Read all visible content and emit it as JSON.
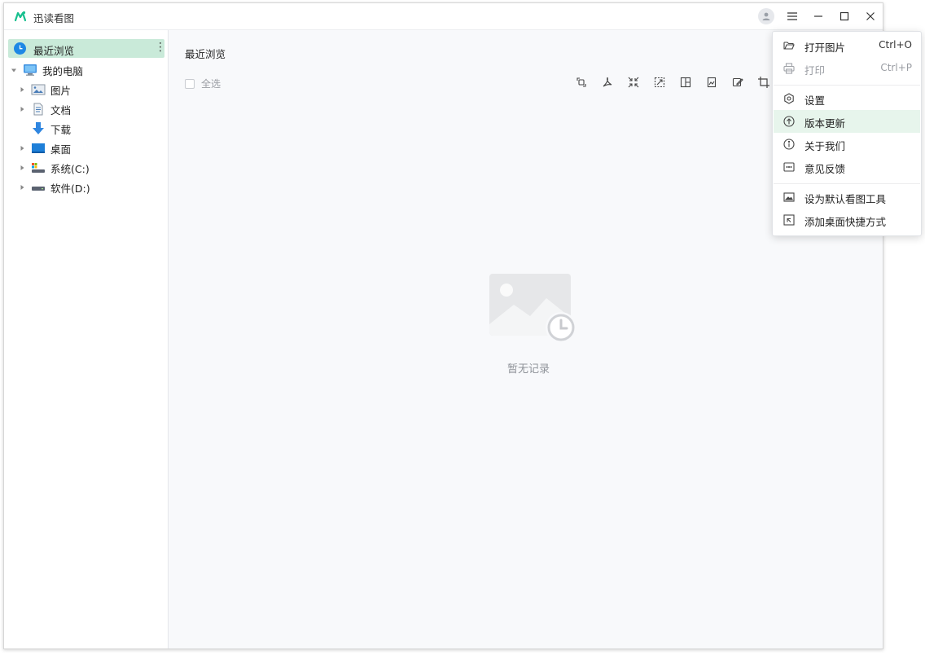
{
  "app": {
    "title": "迅读看图",
    "brand_color": "#18c08f",
    "icon": "app-logo-icon"
  },
  "titlebar": {
    "buttons": [
      "user-avatar-icon",
      "hamburger-menu-icon",
      "minimize-icon",
      "maximize-icon",
      "close-icon"
    ]
  },
  "sidebar": {
    "recent": {
      "label": "最近浏览",
      "icon": "clock-icon",
      "highlight_color": "#c9ead9"
    },
    "tree": [
      {
        "label": "我的电脑",
        "icon": "computer-icon",
        "expanded": true
      },
      {
        "label": "图片",
        "icon": "pictures-folder-icon"
      },
      {
        "label": "文档",
        "icon": "documents-folder-icon"
      },
      {
        "label": "下载",
        "icon": "download-arrow-icon"
      },
      {
        "label": "桌面",
        "icon": "desktop-icon"
      },
      {
        "label": "系统(C:)",
        "icon": "system-drive-icon"
      },
      {
        "label": "软件(D:)",
        "icon": "drive-icon"
      }
    ]
  },
  "main": {
    "breadcrumb": "最近浏览",
    "select_all_label": "全选",
    "toolbar": [
      "convert-icon",
      "pdf-icon",
      "compress-icon",
      "resize-icon",
      "layout-icon",
      "print-image-icon",
      "edit-icon",
      "crop-icon"
    ],
    "empty_text": "暂无记录"
  },
  "menu": {
    "items": [
      {
        "label": "打开图片",
        "shortcut": "Ctrl+O",
        "icon": "folder-open-icon"
      },
      {
        "label": "打印",
        "shortcut": "Ctrl+P",
        "icon": "printer-icon",
        "disabled": true
      },
      {
        "label": "设置",
        "icon": "settings-hex-icon"
      },
      {
        "label": "版本更新",
        "icon": "update-arrow-icon",
        "highlighted": true
      },
      {
        "label": "关于我们",
        "icon": "info-icon"
      },
      {
        "label": "意见反馈",
        "icon": "feedback-icon"
      },
      {
        "label": "设为默认看图工具",
        "icon": "image-default-icon"
      },
      {
        "label": "添加桌面快捷方式",
        "icon": "shortcut-icon"
      }
    ],
    "highlight_color": "#e7f5ec"
  }
}
